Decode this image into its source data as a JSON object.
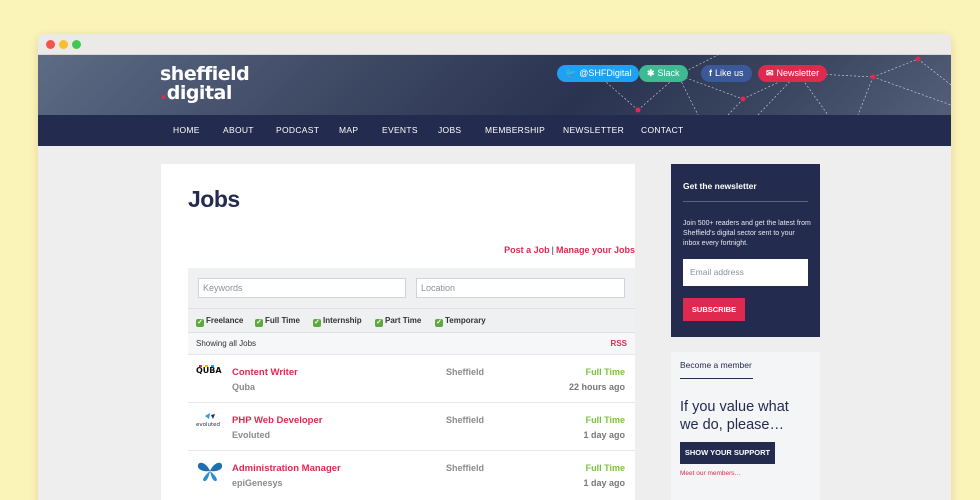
{
  "site": {
    "logo_line1": "sheffield",
    "logo_dot": ".",
    "logo_line2": "digital"
  },
  "social": [
    {
      "icon": "twitter-icon",
      "glyph": "🐦",
      "label": "@SHFDigital",
      "color": "#1da1f2"
    },
    {
      "icon": "slack-icon",
      "glyph": "✱",
      "label": "Slack",
      "color": "#3eb991"
    },
    {
      "icon": "facebook-icon",
      "glyph": "f",
      "label": "Like us",
      "color": "#3b5998"
    },
    {
      "icon": "mail-icon",
      "glyph": "✉",
      "label": "Newsletter",
      "color": "#e0294f"
    }
  ],
  "nav": [
    "HOME",
    "ABOUT",
    "PODCAST",
    "MAP",
    "EVENTS",
    "JOBS",
    "MEMBERSHIP",
    "NEWSLETTER",
    "CONTACT"
  ],
  "page": {
    "title": "Jobs",
    "post_job": "Post a Job",
    "manage_jobs": "Manage your Jobs"
  },
  "search": {
    "keywords_placeholder": "Keywords",
    "location_placeholder": "Location"
  },
  "job_types": [
    "Freelance",
    "Full Time",
    "Internship",
    "Part Time",
    "Temporary"
  ],
  "listing": {
    "status": "Showing all Jobs",
    "rss": "RSS"
  },
  "jobs": [
    {
      "title": "Content Writer",
      "company": "Quba",
      "location": "Sheffield",
      "type": "Full Time",
      "posted": "22 hours ago",
      "logo": "quba-logo",
      "logo_text": "QUBA"
    },
    {
      "title": "PHP Web Developer",
      "company": "Evoluted",
      "location": "Sheffield",
      "type": "Full Time",
      "posted": "1 day ago",
      "logo": "evoluted-logo",
      "logo_text": "evoluted"
    },
    {
      "title": "Administration Manager",
      "company": "epiGenesys",
      "location": "Sheffield",
      "type": "Full Time",
      "posted": "1 day ago",
      "logo": "epigenesys-logo",
      "logo_text": ""
    }
  ],
  "newsletter": {
    "title": "Get the newsletter",
    "text": "Join 500+ readers and get the latest from Sheffield's digital sector sent to your inbox every fortnight.",
    "email_placeholder": "Email address",
    "subscribe": "SUBSCRIBE"
  },
  "membership": {
    "title": "Become a member",
    "tagline": "If you value what we do, please…",
    "button": "SHOW YOUR SUPPORT",
    "link": "Meet our members…"
  },
  "colors": {
    "navy": "#232b4f",
    "accent": "#e0294f",
    "green": "#7bc142",
    "background": "#fbf4b8"
  }
}
